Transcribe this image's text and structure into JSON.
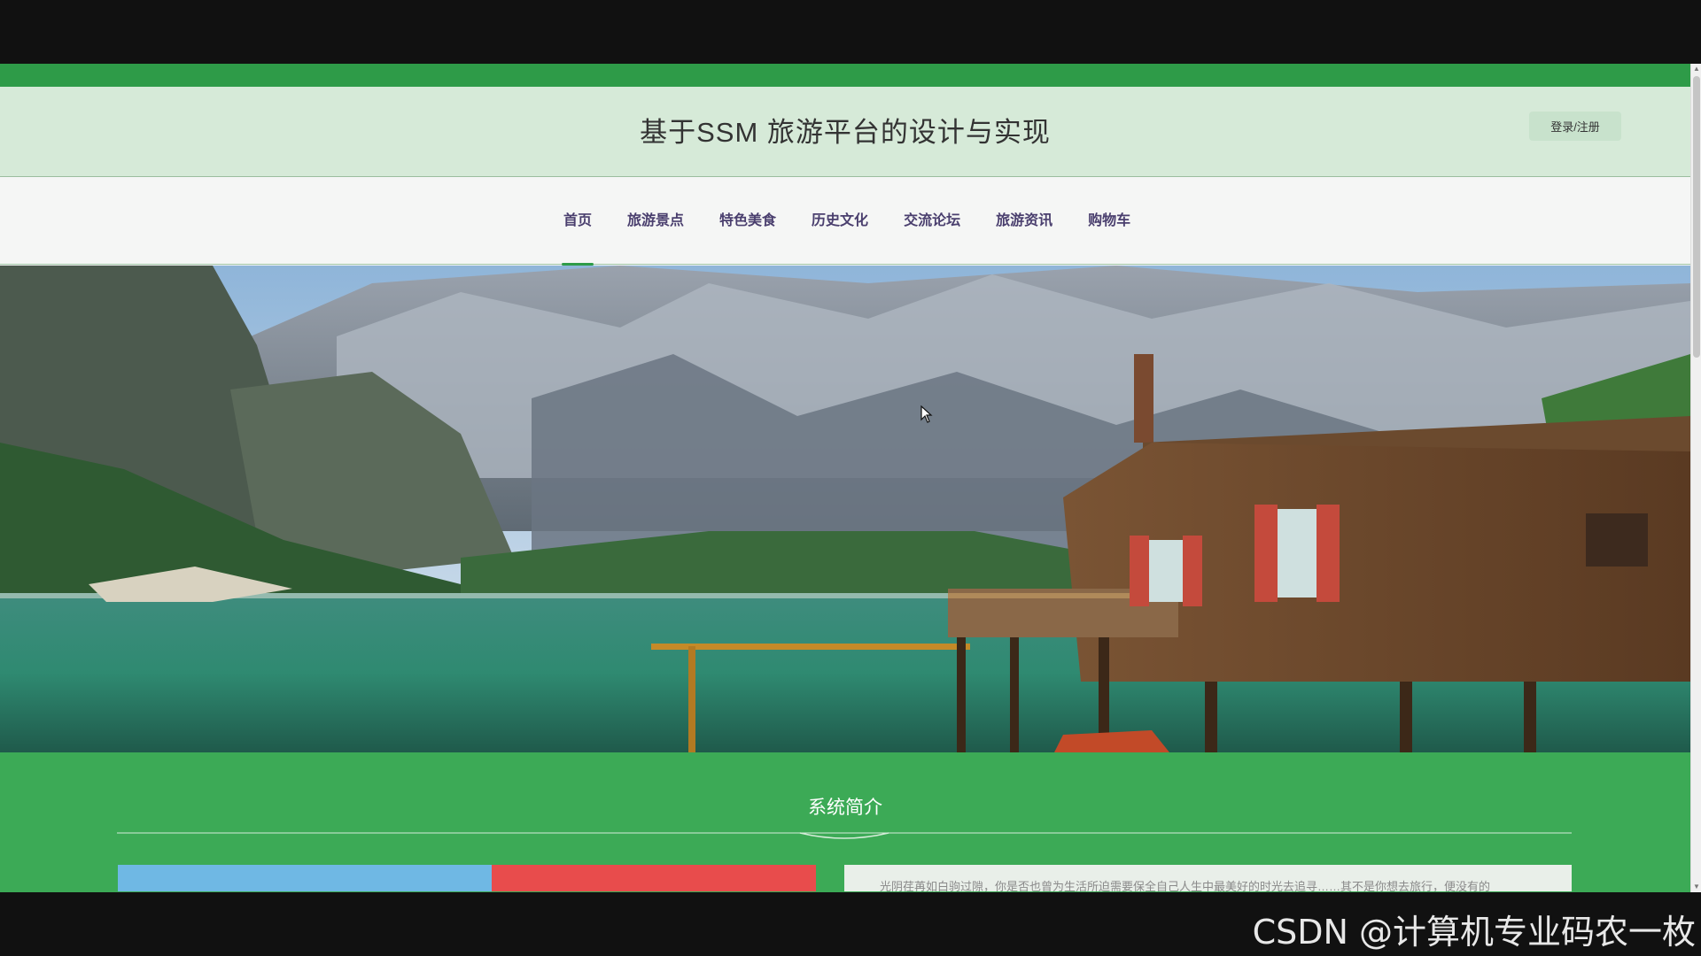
{
  "header": {
    "site_title": "基于SSM 旅游平台的设计与实现",
    "login_label": "登录/注册"
  },
  "nav": {
    "items": [
      {
        "label": "首页",
        "active": true
      },
      {
        "label": "旅游景点"
      },
      {
        "label": "特色美食"
      },
      {
        "label": "历史文化"
      },
      {
        "label": "交流论坛"
      },
      {
        "label": "旅游资讯"
      },
      {
        "label": "购物车"
      }
    ]
  },
  "carousel": {
    "slide_count": 3,
    "active_index": 0
  },
  "intro": {
    "title": "系统简介",
    "text": "光阴荏苒如白驹过隙，你是否也曾为生活所迫需要保全自己人生中最美好的时光去追寻……其不是你想去旅行，便没有的"
  },
  "watermark": "CSDN @计算机专业码农一枚",
  "colors": {
    "brand_green": "#2e9b48",
    "intro_green": "#3caa56",
    "header_bg": "#d6ead8",
    "nav_text": "#4a3f6e"
  }
}
